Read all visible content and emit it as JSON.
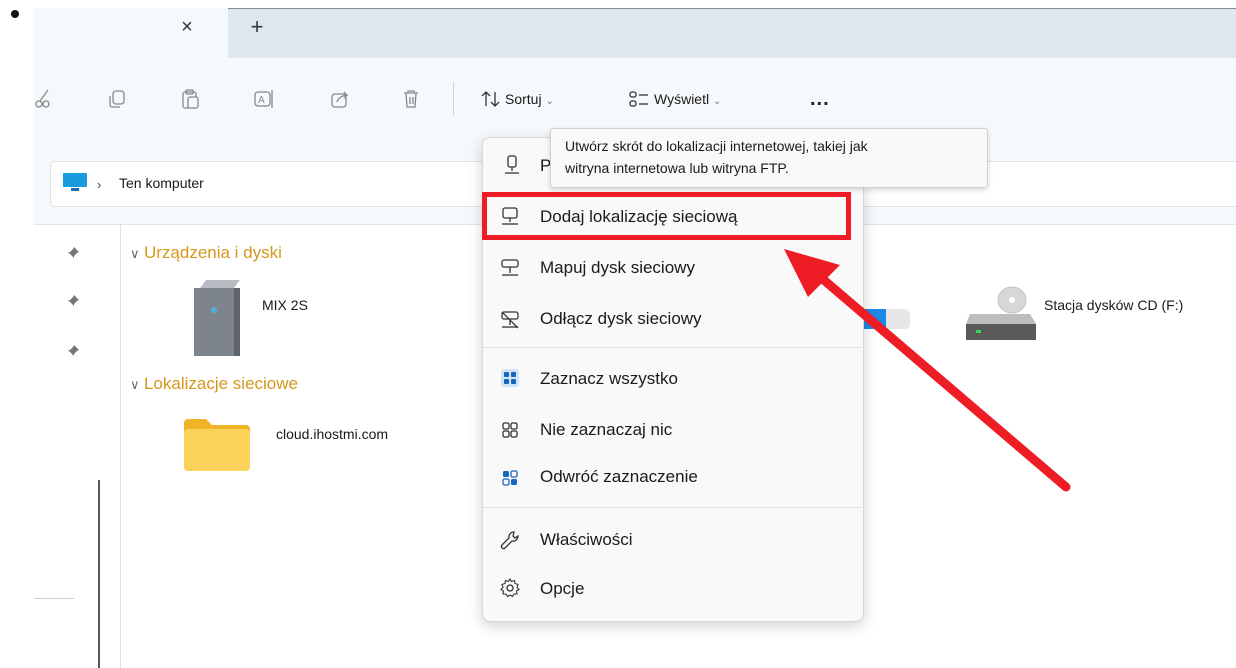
{
  "tabs": {
    "close_glyph": "×",
    "add_glyph": "+"
  },
  "toolbar": {
    "sort_label": "Sortuj",
    "view_label": "Wyświetl",
    "more_label": "..."
  },
  "address": {
    "location": "Ten komputer",
    "separator": "›"
  },
  "groups": [
    {
      "label": "Urządzenia i dyski",
      "chevron": "∨"
    },
    {
      "label": "Lokalizacje sieciowe",
      "chevron": "∨"
    }
  ],
  "items": {
    "drive": "MIX 2S",
    "cd": "Stacja dysków CD (F:)",
    "network_folder": "cloud.ihostmi.com",
    "drive_usage_fraction": 0.5
  },
  "tooltip": {
    "line1": "Utwórz skrót do lokalizacji internetowej, takiej jak",
    "line2": "witryna internetowa lub witryna FTP."
  },
  "menu": {
    "items": [
      {
        "label": "P",
        "icon": "pin-network-icon"
      },
      {
        "label": "Dodaj lokalizację sieciową",
        "icon": "network-location-icon"
      },
      {
        "label": "Mapuj dysk sieciowy",
        "icon": "map-drive-icon"
      },
      {
        "label": "Odłącz dysk sieciowy",
        "icon": "disconnect-drive-icon"
      },
      {
        "label": "Zaznacz wszystko",
        "icon": "select-all-icon"
      },
      {
        "label": "Nie zaznaczaj nic",
        "icon": "select-none-icon"
      },
      {
        "label": "Odwróć zaznaczenie",
        "icon": "invert-selection-icon"
      },
      {
        "label": "Właściwości",
        "icon": "wrench-icon"
      },
      {
        "label": "Opcje",
        "icon": "gear-icon"
      }
    ]
  },
  "colors": {
    "highlight": "#ee1c25",
    "accent": "#1e88e5",
    "group": "#d6971c"
  }
}
